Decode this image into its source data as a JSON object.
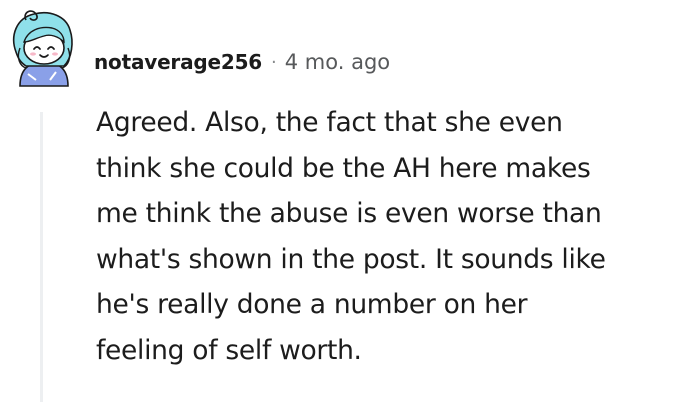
{
  "comment": {
    "username": "notaverage256",
    "separator": "·",
    "timestamp": "4 mo. ago",
    "avatar_icon": "snoo-avatar-icon",
    "body_lines": [
      "Agreed. Also, the fact that she even",
      "think she could be the AH here makes",
      "me think the abuse is even worse than",
      "what's shown in the post. It sounds like",
      "he's really done a number on her",
      "feeling of self worth."
    ]
  },
  "colors": {
    "text": "#1c1c1c",
    "meta": "#57595b",
    "thread_line": "#edeff1",
    "avatar_hair": "#7fd8e6",
    "avatar_shirt": "#8aa0e8"
  }
}
